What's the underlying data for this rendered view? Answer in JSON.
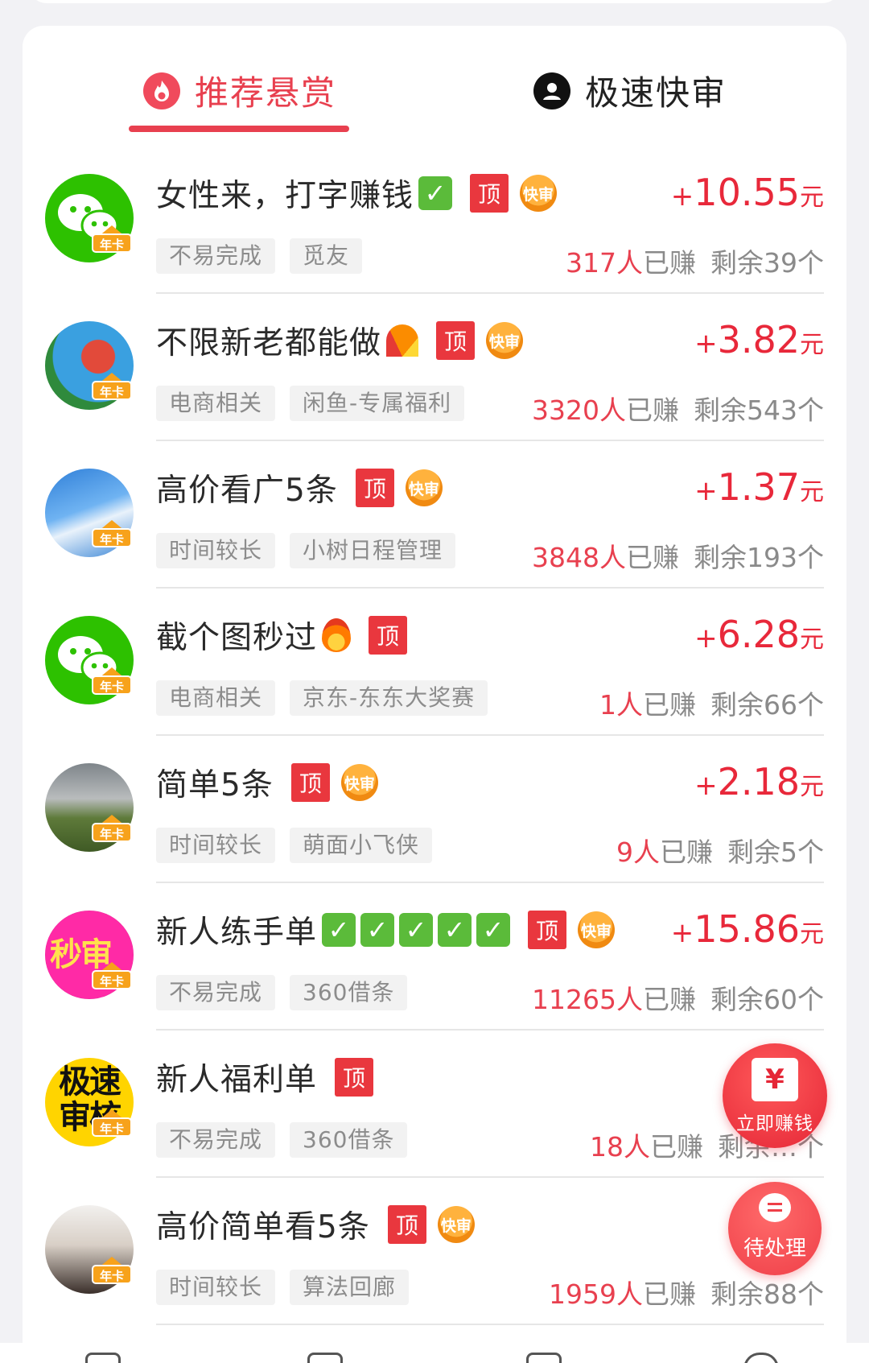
{
  "tabs": [
    {
      "label": "推荐悬赏",
      "icon": "flame-icon",
      "active": true
    },
    {
      "label": "极速快审",
      "icon": "user-circle-icon",
      "active": false
    }
  ],
  "badges": {
    "top": "顶",
    "fast": "快审",
    "year_card": "年卡"
  },
  "tasks": [
    {
      "title": "女性来，打字赚钱",
      "emoji": "check",
      "emoji_count": 1,
      "fast": true,
      "tags": [
        "不易完成",
        "觅友"
      ],
      "reward_sign": "+",
      "reward": "10.55",
      "unit": "元",
      "earned": "317人",
      "earned_label": "已赚",
      "remaining": "剩余39个",
      "avatar": "wechat"
    },
    {
      "title": "不限新老都能做",
      "emoji": "rainbow",
      "emoji_count": 1,
      "fast": true,
      "tags": [
        "电商相关",
        "闲鱼-专属福利"
      ],
      "reward_sign": "+",
      "reward": "3.82",
      "unit": "元",
      "earned": "3320人",
      "earned_label": "已赚",
      "remaining": "剩余543个",
      "avatar": "cartoon"
    },
    {
      "title": "高价看广5条",
      "emoji": "",
      "emoji_count": 0,
      "fast": true,
      "tags": [
        "时间较长",
        "小树日程管理"
      ],
      "reward_sign": "+",
      "reward": "1.37",
      "unit": "元",
      "earned": "3848人",
      "earned_label": "已赚",
      "remaining": "剩余193个",
      "avatar": "thumb"
    },
    {
      "title": "截个图秒过",
      "emoji": "fire",
      "emoji_count": 1,
      "fast": false,
      "tags": [
        "电商相关",
        "京东-东东大奖赛"
      ],
      "reward_sign": "+",
      "reward": "6.28",
      "unit": "元",
      "earned": "1人",
      "earned_label": "已赚",
      "remaining": "剩余66个",
      "avatar": "wechat"
    },
    {
      "title": "简单5条",
      "emoji": "",
      "emoji_count": 0,
      "fast": true,
      "tags": [
        "时间较长",
        "萌面小飞侠"
      ],
      "reward_sign": "+",
      "reward": "2.18",
      "unit": "元",
      "earned": "9人",
      "earned_label": "已赚",
      "remaining": "剩余5个",
      "avatar": "photo-girl"
    },
    {
      "title": "新人练手单",
      "emoji": "check",
      "emoji_count": 5,
      "fast": true,
      "tags": [
        "不易完成",
        "360借条"
      ],
      "reward_sign": "+",
      "reward": "15.86",
      "unit": "元",
      "earned": "11265人",
      "earned_label": "已赚",
      "remaining": "剩余60个",
      "avatar": "miaoshen"
    },
    {
      "title": "新人福利单",
      "emoji": "",
      "emoji_count": 0,
      "fast": false,
      "tags": [
        "不易完成",
        "360借条"
      ],
      "reward_sign": "",
      "reward": "",
      "unit": "",
      "earned": "18人",
      "earned_label": "已赚",
      "remaining": "剩余…个",
      "avatar": "jisu"
    },
    {
      "title": "高价简单看5条",
      "emoji": "",
      "emoji_count": 0,
      "fast": true,
      "tags": [
        "时间较长",
        "算法回廊"
      ],
      "reward_sign": "",
      "reward": "",
      "unit": "",
      "earned": "1959人",
      "earned_label": "已赚",
      "remaining": "剩余88个",
      "avatar": "photo-woman"
    }
  ],
  "floating": {
    "earn_symbol": "¥",
    "earn_label": "立即赚钱",
    "pending_label": "待处理"
  },
  "colors": {
    "accent": "#e8404f",
    "reward": "#e8283a",
    "top_badge": "#e9373e",
    "fast_badge": "#f5a623"
  }
}
